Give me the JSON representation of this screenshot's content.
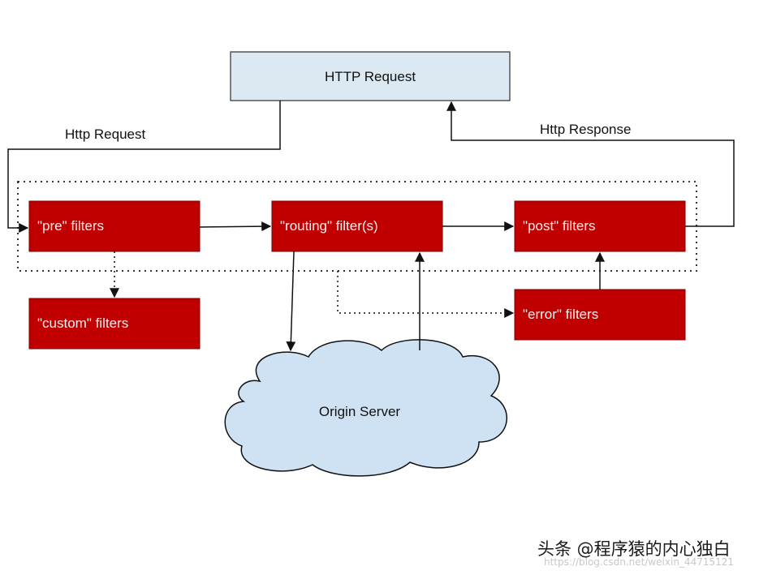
{
  "colors": {
    "filter_fill": "#c00000",
    "filter_text": "#f2f2f2",
    "request_fill": "#dce9f2",
    "cloud_fill": "#cfe2f3",
    "line": "#111111"
  },
  "nodes": {
    "http_request": "HTTP Request",
    "pre": "\"pre\" filters",
    "routing": "\"routing\" filter(s)",
    "post": "\"post\" filters",
    "custom": "\"custom\" filters",
    "error": "\"error\" filters",
    "origin": "Origin Server"
  },
  "edge_labels": {
    "request": "Http Request",
    "response": "Http Response"
  },
  "watermark": {
    "text": "头条 @程序猿的内心独白",
    "faint": "https://blog.csdn.net/weixin_44715121"
  }
}
